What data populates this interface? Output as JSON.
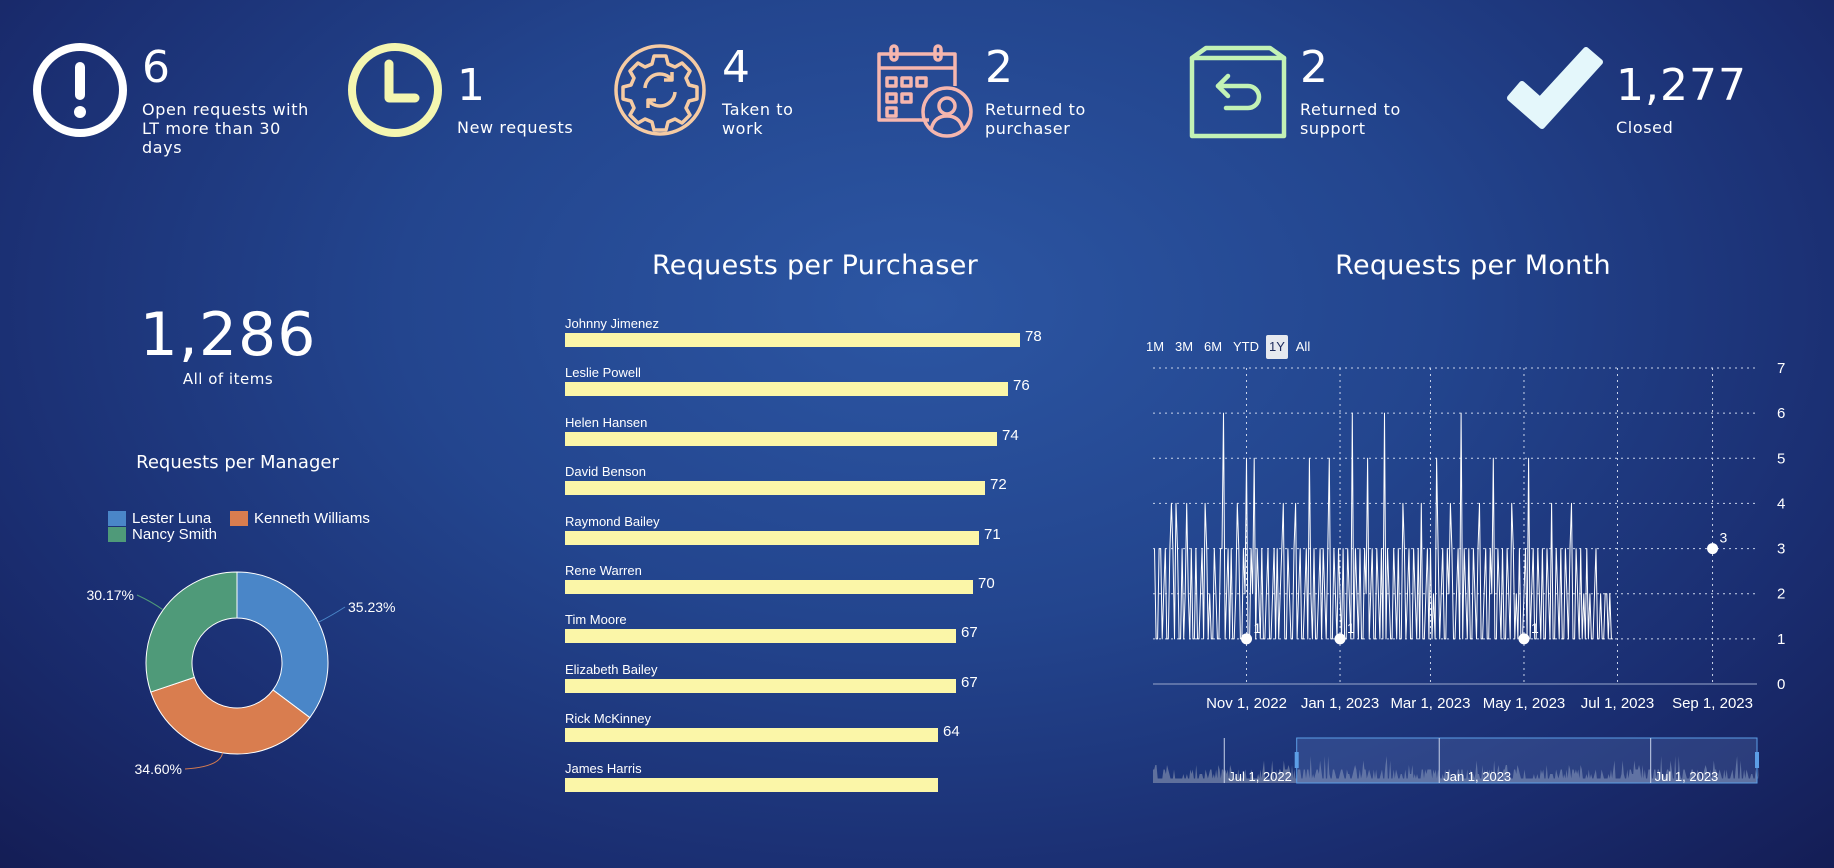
{
  "kpis": [
    {
      "icon": "exclamation-circle-icon",
      "value": "6",
      "label_lines": [
        "Open requests with",
        "LT more than 30",
        "days"
      ],
      "color": "#ffffff"
    },
    {
      "icon": "clock-icon",
      "value": "1",
      "label_lines": [
        "New requests"
      ],
      "color": "#f4f6b0"
    },
    {
      "icon": "gear-refresh-icon",
      "value": "4",
      "label_lines": [
        "Taken to",
        "work"
      ],
      "color": "#f6cba3"
    },
    {
      "icon": "calendar-person-icon",
      "value": "2",
      "label_lines": [
        "Returned to",
        "purchaser"
      ],
      "color": "#f6b6ae"
    },
    {
      "icon": "box-return-icon",
      "value": "2",
      "label_lines": [
        "Returned to",
        "support"
      ],
      "color": "#c2f2b5"
    },
    {
      "icon": "checkmark-icon",
      "value": "1,277",
      "label_lines": [
        "Closed"
      ],
      "color": "#e4f7fb"
    }
  ],
  "total": {
    "value": "1,286",
    "label": "All of items"
  },
  "manager_chart": {
    "title": "Requests per Manager",
    "legend": [
      {
        "name": "Lester Luna",
        "color": "#4a86c8"
      },
      {
        "name": "Kenneth Williams",
        "color": "#d97d4f"
      },
      {
        "name": "Nancy Smith",
        "color": "#4f9a79"
      }
    ]
  },
  "purchaser_chart_title": "Requests per Purchaser",
  "month_chart": {
    "title": "Requests per Month",
    "range_buttons": [
      "1M",
      "3M",
      "6M",
      "YTD",
      "1Y",
      "All"
    ],
    "active_range": "1Y",
    "navigator_labels": [
      "Jul 1, 2022",
      "Jan 1, 2023",
      "Jul 1, 2023"
    ]
  },
  "chart_data": [
    {
      "type": "pie",
      "title": "Requests per Manager",
      "categories": [
        "Lester Luna",
        "Kenneth Williams",
        "Nancy Smith"
      ],
      "values": [
        35.23,
        34.6,
        30.17
      ],
      "data_labels": [
        "35.23%",
        "34.60%",
        "30.17%"
      ],
      "colors": [
        "#4a86c8",
        "#d97d4f",
        "#4f9a79"
      ],
      "donut": true,
      "legend": "top"
    },
    {
      "type": "bar",
      "orientation": "horizontal",
      "title": "Requests per Purchaser",
      "categories": [
        "Johnny Jimenez",
        "Leslie Powell",
        "Helen Hansen",
        "David Benson",
        "Raymond Bailey",
        "Rene Warren",
        "Tim Moore",
        "Elizabeth Bailey",
        "Rick McKinney",
        "James Harris"
      ],
      "values": [
        78,
        76,
        74,
        72,
        71,
        70,
        67,
        67,
        64,
        64
      ],
      "data_labels": [
        "78",
        "76",
        "74",
        "72",
        "71",
        "70",
        "67",
        "67",
        "64",
        ""
      ],
      "color": "#fbf6a8"
    },
    {
      "type": "line",
      "title": "Requests per Month",
      "x_range": [
        "2022-09-01",
        "2023-09-30"
      ],
      "x_ticks": [
        "Nov 1, 2022",
        "Jan 1, 2023",
        "Mar 1, 2023",
        "May 1, 2023",
        "Jul 1, 2023",
        "Sep 1, 2023"
      ],
      "y_ticks": [
        "0",
        "1",
        "2",
        "3",
        "4",
        "5",
        "6",
        "7"
      ],
      "ylim": [
        0,
        7
      ],
      "grid": true,
      "series": [
        {
          "start_date": "2022-09-02",
          "values": [
            3,
            1,
            1,
            3,
            3,
            1,
            2,
            3,
            1,
            1,
            3,
            4,
            3,
            1,
            4,
            3,
            1,
            1,
            3,
            1,
            2,
            4,
            2,
            1,
            3,
            1,
            1,
            3,
            1,
            1,
            2,
            3,
            1,
            4,
            3,
            1,
            2,
            1,
            1,
            3,
            2,
            1,
            1,
            3,
            3,
            6,
            1,
            2,
            3,
            1,
            3,
            1,
            1,
            2,
            4,
            3,
            1,
            1,
            3,
            2,
            5,
            1,
            1,
            3,
            2,
            5,
            1,
            3,
            2,
            1,
            3,
            1,
            1,
            2,
            3,
            1,
            1,
            2,
            3,
            1,
            3,
            1,
            2,
            3,
            4,
            1,
            1,
            3,
            2,
            1,
            1,
            3,
            4,
            1,
            2,
            3,
            1,
            1,
            2,
            3,
            1,
            5,
            2,
            1,
            3,
            1,
            1,
            2,
            3,
            1,
            3,
            2,
            1,
            3,
            5,
            1,
            1,
            3,
            2,
            1,
            3,
            2,
            1,
            3,
            1,
            1,
            3,
            2,
            1,
            6,
            1,
            3,
            2,
            1,
            3,
            1,
            1,
            3,
            2,
            5,
            1,
            2,
            3,
            1,
            1,
            3,
            2,
            1,
            3,
            1,
            6,
            1,
            3,
            2,
            1,
            1,
            3,
            2,
            1,
            3,
            1,
            1,
            4,
            3,
            1,
            2,
            3,
            1,
            1,
            3,
            2,
            1,
            3,
            1,
            4,
            1,
            1,
            2,
            3,
            1,
            3,
            1,
            2,
            1,
            5,
            3,
            1,
            2,
            3,
            1,
            1,
            3,
            2,
            4,
            3,
            1,
            1,
            2,
            3,
            1,
            6,
            1,
            3,
            2,
            1,
            3,
            1,
            1,
            3,
            2,
            1,
            3,
            4,
            1,
            1,
            2,
            3,
            1,
            1,
            3,
            2,
            5,
            1,
            1,
            3,
            2,
            1,
            3,
            1,
            1,
            3,
            2,
            1,
            4,
            3,
            1,
            2,
            1,
            3,
            1,
            1,
            2,
            3,
            1,
            5,
            1,
            2,
            3,
            1,
            1,
            3,
            2,
            1,
            3,
            1,
            1,
            3,
            2,
            1,
            4,
            1,
            1,
            3,
            2,
            1,
            3,
            1,
            1,
            3,
            2,
            1,
            3,
            4,
            1,
            1,
            3,
            2,
            1,
            3,
            1,
            2,
            1,
            3,
            1,
            2,
            1,
            1,
            2,
            3,
            1,
            1,
            2,
            1,
            1,
            2,
            2,
            1,
            2,
            1,
            1
          ]
        }
      ],
      "annotations": [
        {
          "date": "2022-11-01",
          "value": 1,
          "label": "1"
        },
        {
          "date": "2023-01-01",
          "value": 1,
          "label": "1"
        },
        {
          "date": "2023-05-01",
          "value": 1,
          "label": "1"
        },
        {
          "date": "2023-09-01",
          "value": 3,
          "label": "3"
        }
      ]
    }
  ]
}
